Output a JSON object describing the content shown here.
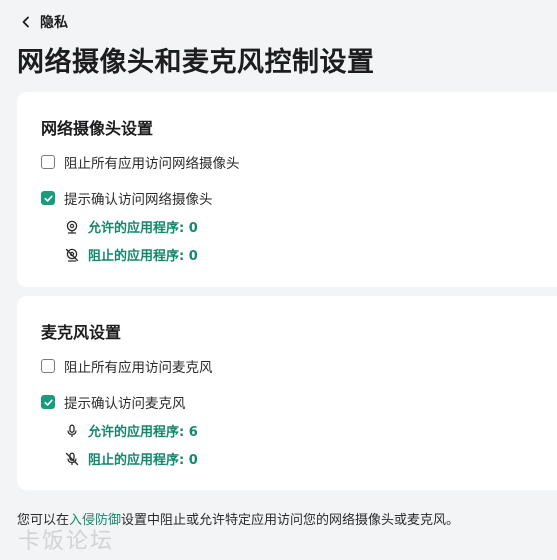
{
  "header": {
    "back_label": "隐私",
    "title": "网络摄像头和麦克风控制设置"
  },
  "webcam": {
    "title": "网络摄像头设置",
    "block_all_label": "阻止所有应用访问网络摄像头",
    "block_all_checked": false,
    "prompt_label": "提示确认访问网络摄像头",
    "prompt_checked": true,
    "allowed_label": "允许的应用程序: 0",
    "blocked_label": "阻止的应用程序: 0"
  },
  "microphone": {
    "title": "麦克风设置",
    "block_all_label": "阻止所有应用访问麦克风",
    "block_all_checked": false,
    "prompt_label": "提示确认访问麦克风",
    "prompt_checked": true,
    "allowed_label": "允许的应用程序: 6",
    "blocked_label": "阻止的应用程序: 0"
  },
  "footer": {
    "text_before": "您可以在",
    "link_text": "入侵防御",
    "text_after": "设置中阻止或允许特定应用访问您的网络摄像头或麦克风。"
  },
  "watermark": "卡饭论坛",
  "colors": {
    "accent": "#1a9b7d",
    "link": "#14876c",
    "background": "#f2f4f6",
    "card": "#ffffff"
  }
}
